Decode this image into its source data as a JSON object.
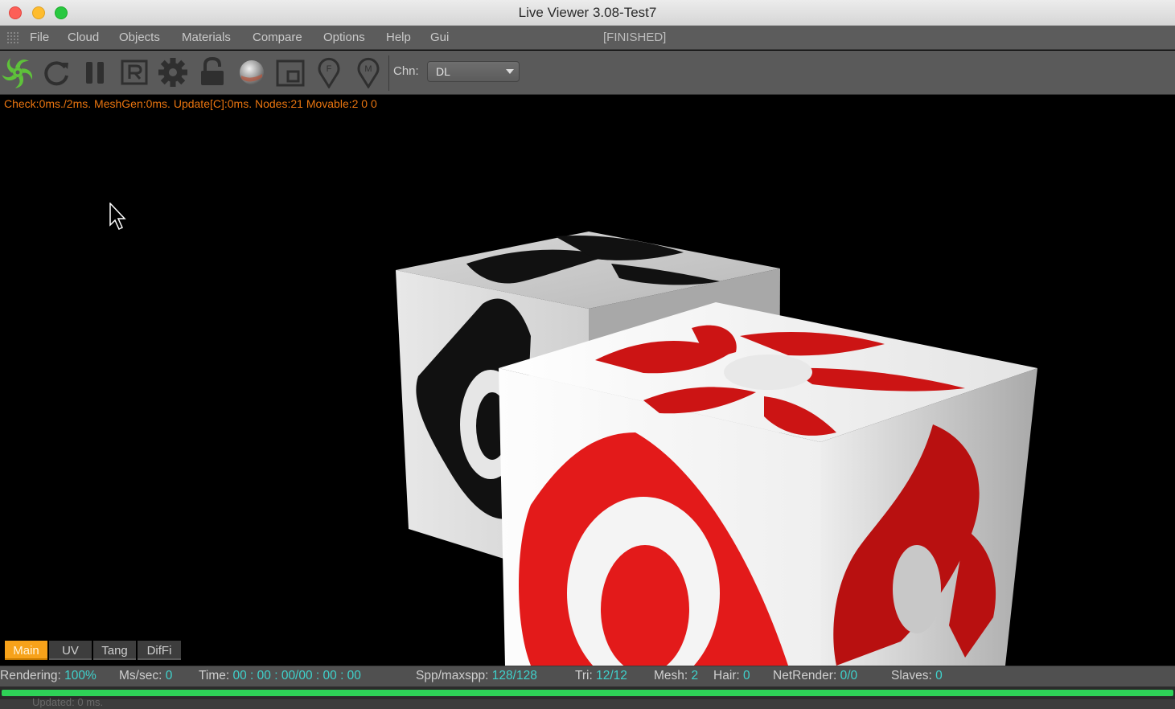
{
  "window": {
    "title": "Live Viewer 3.08-Test7"
  },
  "menu": {
    "items": [
      "File",
      "Cloud",
      "Objects",
      "Materials",
      "Compare",
      "Options",
      "Help",
      "Gui"
    ],
    "status": "[FINISHED]"
  },
  "toolbar": {
    "icons": [
      "octane-logo-icon",
      "refresh-icon",
      "pause-icon",
      "r-icon",
      "gear-icon",
      "lock-icon",
      "material-ball-icon",
      "region-icon",
      "focus-pin-icon",
      "material-pin-icon"
    ],
    "channel_label": "Chn:",
    "channel_value": "DL",
    "accent": "#5ec23a"
  },
  "viewport": {
    "debug_text": "Check:0ms./2ms. MeshGen:0ms. Update[C]:0ms. Nodes:21 Movable:2  0 0"
  },
  "view_tabs": [
    {
      "label": "Main",
      "active": true
    },
    {
      "label": "UV",
      "active": false
    },
    {
      "label": "Tang",
      "active": false
    },
    {
      "label": "DifFi",
      "active": false
    }
  ],
  "status": {
    "rendering_label": "Rendering:",
    "rendering_value": "100%",
    "mssec_label": "Ms/sec:",
    "mssec_value": "0",
    "time_label": "Time:",
    "time_value": "00 : 00 : 00/00 : 00 : 00",
    "spp_label": "Spp/maxspp:",
    "spp_value": "128/128",
    "tri_label": "Tri:",
    "tri_value": "12/12",
    "mesh_label": "Mesh:",
    "mesh_value": "2",
    "hair_label": "Hair:",
    "hair_value": "0",
    "netrender_label": "NetRender:",
    "netrender_value": "0/0",
    "slaves_label": "Slaves:",
    "slaves_value": "0",
    "progress": 1.0,
    "value_color": "#3fd2cc",
    "progress_color": "#2ed157"
  },
  "bottom": {
    "text": "Updated: 0 ms."
  }
}
